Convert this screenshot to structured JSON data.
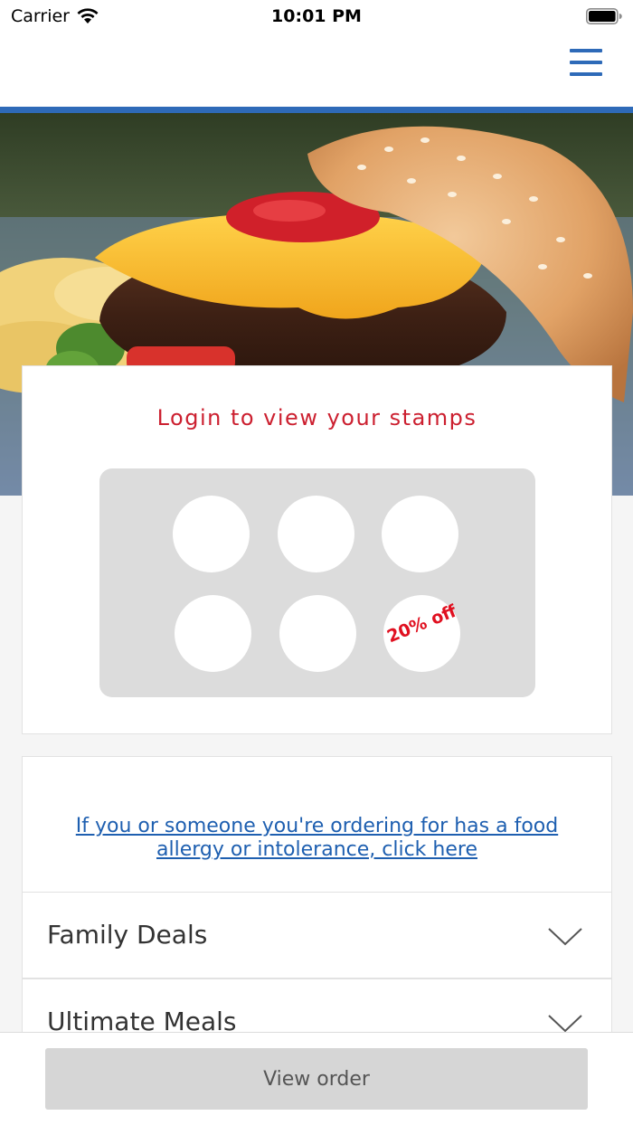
{
  "status_bar": {
    "carrier": "Carrier",
    "time": "10:01 PM"
  },
  "nav": {
    "menu_icon": "hamburger-icon"
  },
  "hero": {
    "image": "burger-photo"
  },
  "stamps": {
    "title": "Login to view your stamps",
    "total_stamps": 6,
    "collected": 0,
    "reward_text": "20% off"
  },
  "allergy": {
    "link_text": "If you or someone you're ordering for has a food allergy or intolerance, click here"
  },
  "categories": [
    {
      "label": "Family Deals",
      "icon": "chevron-down-icon"
    },
    {
      "label": "Ultimate Meals",
      "icon": "chevron-down-icon"
    }
  ],
  "footer": {
    "view_order_label": "View order"
  },
  "colors": {
    "accent": "#2e6ab8",
    "stamp_title": "#cc2030",
    "reward": "#e01020",
    "link": "#1e5fb0"
  }
}
